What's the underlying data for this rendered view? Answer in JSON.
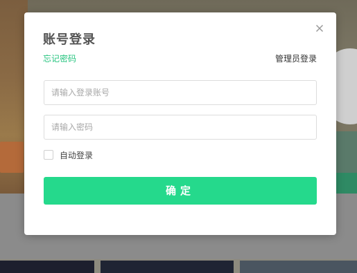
{
  "colors": {
    "accent": "#25d98c",
    "link_green": "#26c47f",
    "overlay": "#8d8a7e"
  },
  "login": {
    "title": "账号登录",
    "forgot_password": "忘记密码",
    "admin_login": "管理员登录",
    "account_input": {
      "placeholder": "请输入登录账号",
      "value": ""
    },
    "password_input": {
      "placeholder": "请输入密码",
      "value": ""
    },
    "remember_label": "自动登录",
    "remember_checked": false,
    "submit_label": "确定",
    "close_icon": "close-icon"
  }
}
